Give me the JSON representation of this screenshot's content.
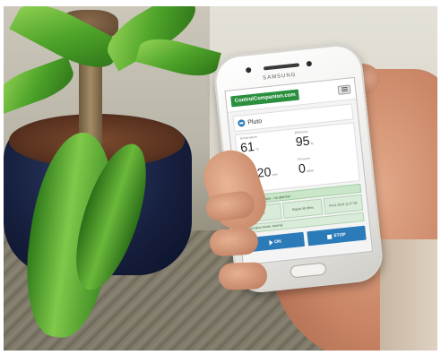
{
  "phone": {
    "brand": "SAMSUNG"
  },
  "app": {
    "logo_text": "ControlCompanion.com",
    "device_name": "Pluto",
    "metrics": [
      {
        "label": "Temperature",
        "value": "61",
        "unit": "°C"
      },
      {
        "label": "Efficiency",
        "value": "95",
        "unit": "%"
      },
      {
        "label": "Speed",
        "value": "3720",
        "unit": "rpm"
      },
      {
        "label": "Pressure",
        "value": "0",
        "unit": "mbar"
      }
    ],
    "status_text": "Everything goes - no alarms!",
    "info": [
      {
        "text": "QIS"
      },
      {
        "text": "Signal: 80 dBm"
      },
      {
        "text": "04.11.2014 11:17:06"
      }
    ],
    "mode_text": "Operation Mode: Internal",
    "buttons": {
      "on_label": "ON",
      "stop_label": "STOP"
    }
  },
  "colors": {
    "logo_green": "#2a8f3e",
    "button_blue": "#2b7bb9",
    "status_green": "#c9e6c9"
  }
}
